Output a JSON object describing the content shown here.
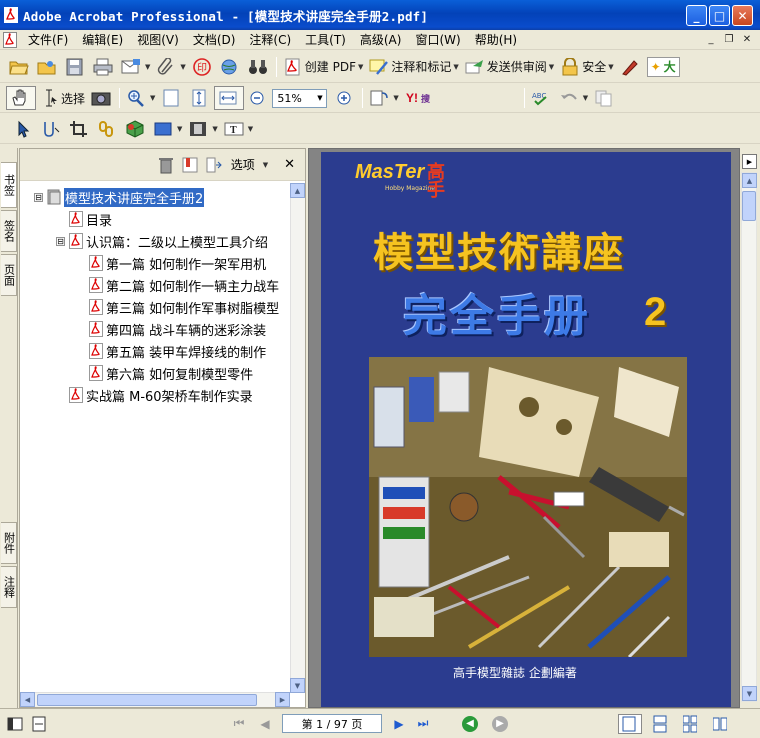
{
  "window": {
    "title": "Adobe Acrobat Professional - [模型技术讲座完全手册2.pdf]",
    "minimize_label": "_",
    "maximize_label": "□",
    "close_label": "✕"
  },
  "menu": {
    "items": [
      "文件(F)",
      "编辑(E)",
      "视图(V)",
      "文档(D)",
      "注释(C)",
      "工具(T)",
      "高级(A)",
      "窗口(W)",
      "帮助(H)"
    ],
    "mdi_minimize": "_",
    "mdi_restore": "❐",
    "mdi_close": "✕"
  },
  "toolbar1": {
    "create_pdf_label": "创建 PDF",
    "comment_label": "注释和标记",
    "review_label": "发送供审阅",
    "security_label": "安全",
    "ime_text": "大"
  },
  "toolbar2": {
    "select_label": "选择",
    "zoom_value": "51%"
  },
  "nav_tabs": {
    "bookmarks": "书签",
    "signatures": "签名",
    "pages": "页面",
    "attachments": "附件",
    "comments": "注释"
  },
  "panel": {
    "options_label": "选项",
    "close_label": "✕"
  },
  "bookmarks": [
    {
      "label": "模型技术讲座完全手册2",
      "level": 0,
      "toggle": "⊟",
      "selected": true
    },
    {
      "label": "目录",
      "level": 1,
      "toggle": "",
      "selected": false
    },
    {
      "label": "认识篇：二级以上模型工具介绍",
      "level": 1,
      "toggle": "⊟",
      "selected": false
    },
    {
      "label": "第一篇  如何制作一架军用机",
      "level": 2,
      "toggle": "",
      "selected": false
    },
    {
      "label": "第二篇  如何制作一辆主力战车",
      "level": 2,
      "toggle": "",
      "selected": false
    },
    {
      "label": "第三篇  如何制作军事树脂模型",
      "level": 2,
      "toggle": "",
      "selected": false
    },
    {
      "label": "第四篇  战斗车辆的迷彩涂装",
      "level": 2,
      "toggle": "",
      "selected": false
    },
    {
      "label": "第五篇  装甲车焊接线的制作",
      "level": 2,
      "toggle": "",
      "selected": false
    },
    {
      "label": "第六篇  如何复制模型零件",
      "level": 2,
      "toggle": "",
      "selected": false
    },
    {
      "label": "实战篇  M-60架桥车制作实录",
      "level": 1,
      "toggle": "",
      "selected": false
    }
  ],
  "cover": {
    "brand": "MasTer",
    "brand_sub": "Hobby Magazine",
    "brand_cn": "高手",
    "title": "模型技術講座",
    "subtitle": "完全手册",
    "number": "2",
    "publisher": "高手模型雜誌 企劃編著"
  },
  "status": {
    "page_indicator": "第 1 / 97 页"
  },
  "colors": {
    "titlebar": "#0a4ccc",
    "cover_bg": "#2b3c8f",
    "title_gold": "#f6c320",
    "selection": "#316ac5"
  }
}
